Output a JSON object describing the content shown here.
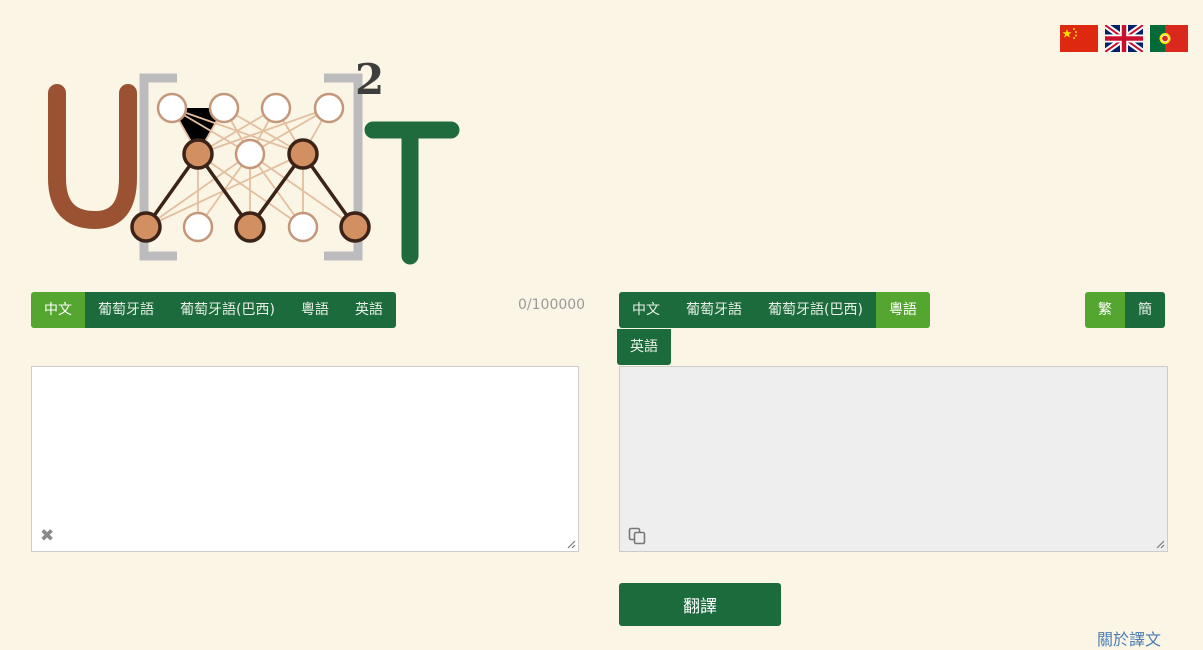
{
  "flags": [
    "chinese-flag-icon",
    "uk-flag-icon",
    "portugal-flag-icon"
  ],
  "source": {
    "languages": [
      "中文",
      "葡萄牙語",
      "葡萄牙語(巴西)",
      "粵語",
      "英語"
    ],
    "active": 0,
    "counter": "0/100000",
    "text": "",
    "placeholder": ""
  },
  "target": {
    "languages": [
      "中文",
      "葡萄牙語",
      "葡萄牙語(巴西)",
      "粵語"
    ],
    "overflow_language": "英語",
    "active": 3,
    "scripts": [
      "繁",
      "簡"
    ],
    "active_script": 0,
    "text": ""
  },
  "translate_label": "翻譯",
  "about_label": "關於譯文",
  "colors": {
    "brand_green": "#1b6b3c",
    "active_green": "#55a630",
    "background": "#fbf5e5"
  }
}
